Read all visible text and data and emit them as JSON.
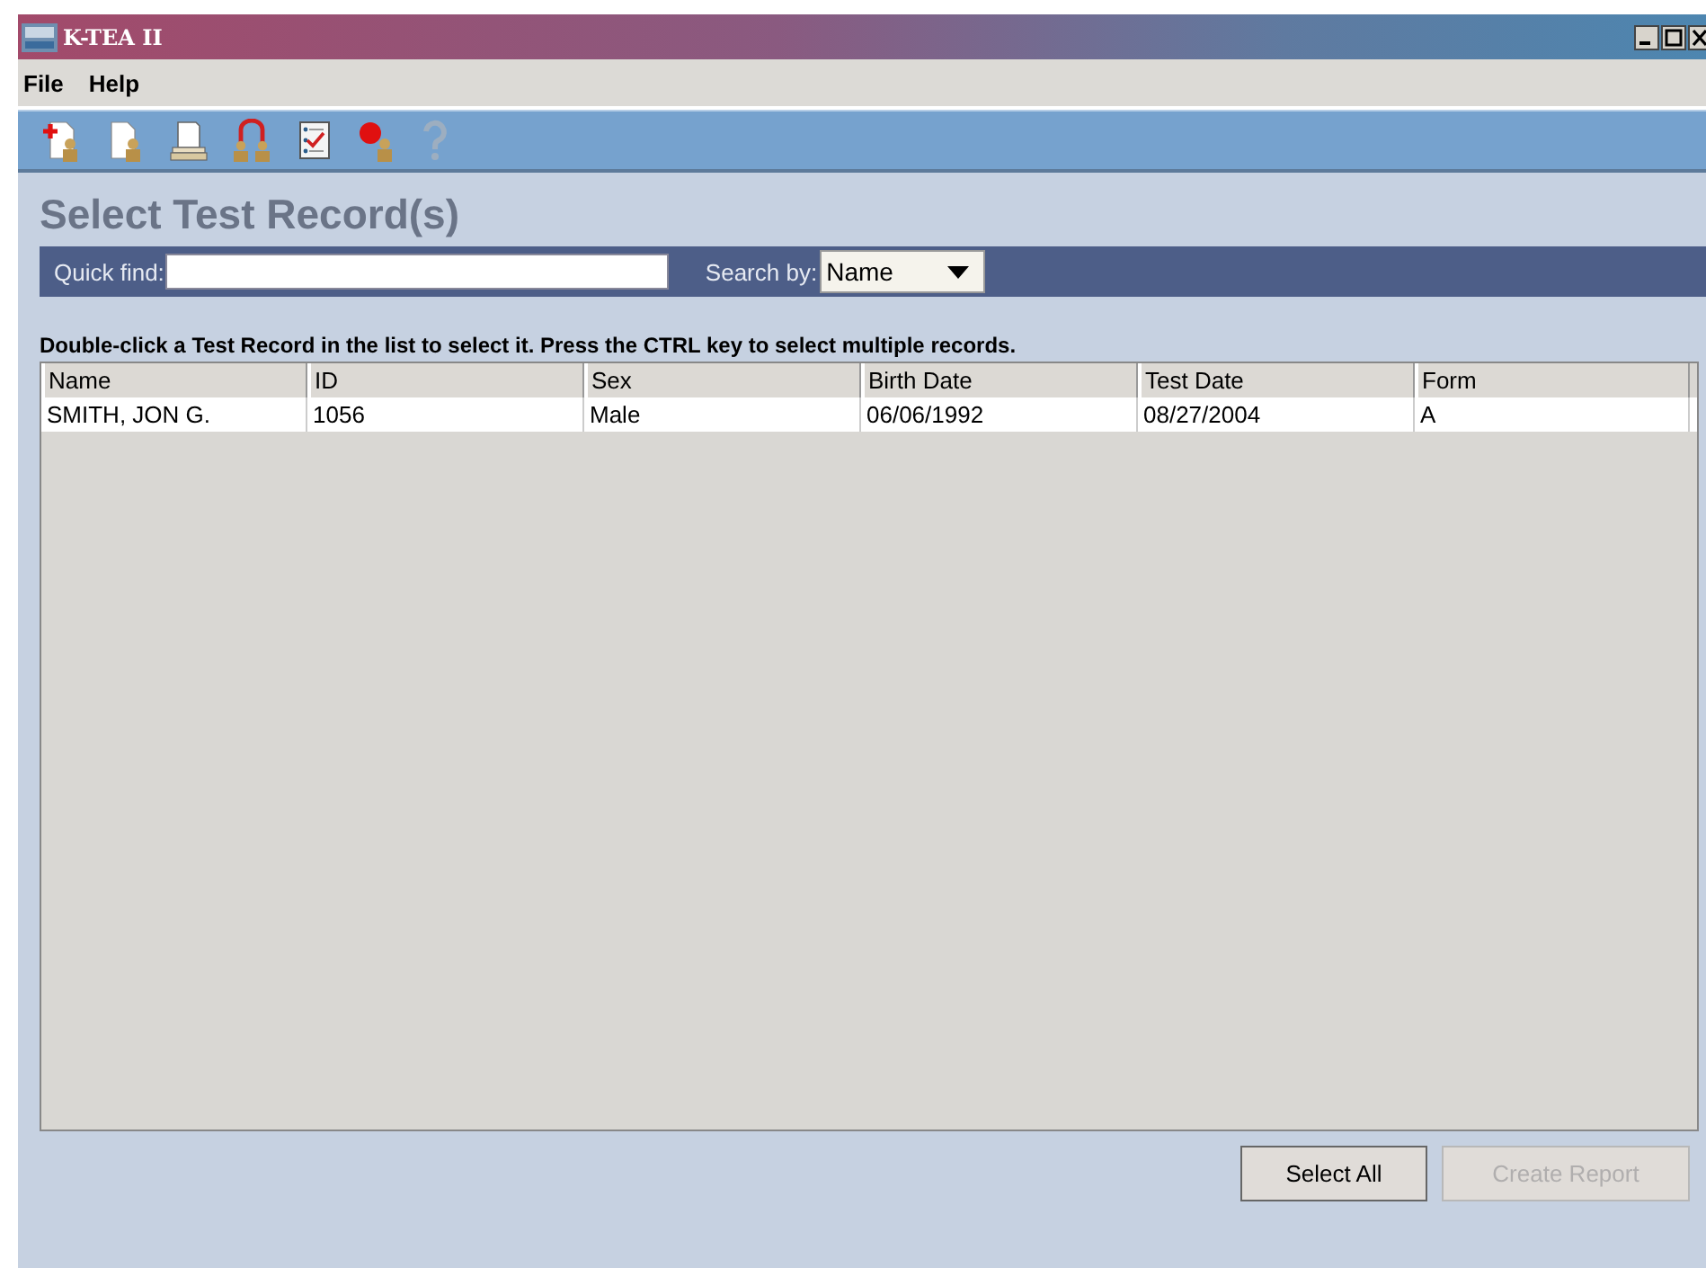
{
  "window": {
    "title": "K-TEA II"
  },
  "menu": [
    "File",
    "Help"
  ],
  "toolbar": [
    {
      "kind": "add-person",
      "disabled": false
    },
    {
      "kind": "person-page",
      "disabled": false
    },
    {
      "kind": "printer",
      "disabled": false
    },
    {
      "kind": "people-link",
      "disabled": false
    },
    {
      "kind": "checklist",
      "disabled": false
    },
    {
      "kind": "stop-person",
      "disabled": false
    },
    {
      "kind": "help",
      "disabled": true
    }
  ],
  "heading": "Select Test Record(s)",
  "search": {
    "label": "Quick find:",
    "search_by_label": "Search by:",
    "search_by": "Name"
  },
  "instruction": "Double-click a Test Record in the list to select it.  Press the CTRL key to select multiple records.",
  "table": {
    "columns": [
      "Name",
      "ID",
      "Sex",
      "Birth Date",
      "Test Date",
      "Form"
    ],
    "rows": [
      {
        "selected": false,
        "cells": [
          "SMITH, JON G.",
          "1056",
          "Male",
          "06/06/1992",
          "08/27/2004",
          "A"
        ]
      }
    ]
  },
  "buttons": [
    {
      "label": "Select All",
      "disabled": false
    },
    {
      "label": "Create Report",
      "disabled": true
    }
  ]
}
